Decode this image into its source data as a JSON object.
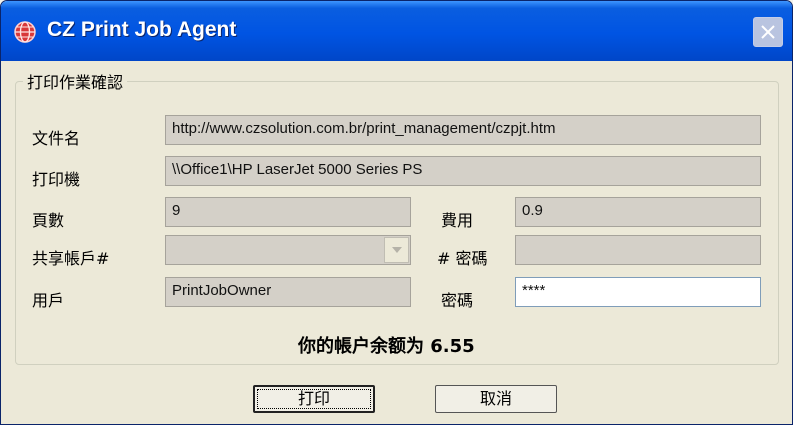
{
  "window": {
    "title": "CZ Print Job Agent",
    "app_icon": "globe-icon",
    "close_icon": "close-icon"
  },
  "group": {
    "title": "打印作業確認"
  },
  "fields": {
    "document": {
      "label": "文件名",
      "value": "http://www.czsolution.com.br/print_management/czpjt.htm"
    },
    "printer": {
      "label": "打印機",
      "value": "\\\\Office1\\HP LaserJet 5000 Series PS"
    },
    "pages": {
      "label": "頁數",
      "value": "9"
    },
    "cost": {
      "label": "費用",
      "value": "0.9"
    },
    "shared_account": {
      "label": "共享帳戶#",
      "value": ""
    },
    "account_password": {
      "label": "# 密碼",
      "value": ""
    },
    "user": {
      "label": "用戶",
      "value": "PrintJobOwner"
    },
    "password": {
      "label": "密碼",
      "value": "****"
    }
  },
  "balance_text": "你的帳户余额为  6.55",
  "buttons": {
    "print": "打印",
    "cancel": "取消"
  }
}
